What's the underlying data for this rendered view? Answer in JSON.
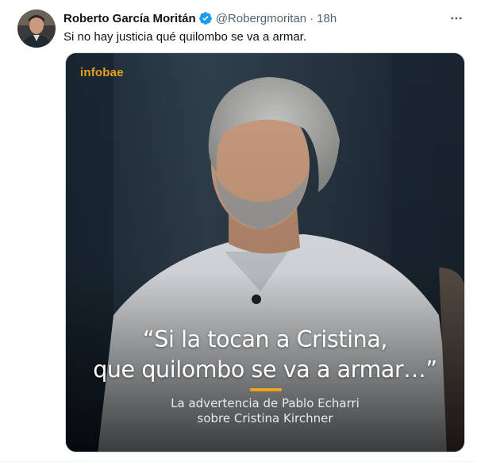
{
  "tweet": {
    "author": {
      "display_name": "Roberto García Moritán",
      "handle": "@Robergmoritan",
      "verified": true
    },
    "separator": "·",
    "timestamp": "18h",
    "text": "Si no hay justicia qué quilombo se va a armar.",
    "more_icon": "more-horizontal-icon"
  },
  "media": {
    "brand": "infobae",
    "quote_line_1": "“Si la tocan a Cristina,",
    "quote_line_2": "que quilombo se va a armar…”",
    "caption_line_1": "La advertencia de Pablo Echarri",
    "caption_line_2": "sobre Cristina Kirchner",
    "accent_color": "#f0a21b"
  },
  "colors": {
    "verified_badge": "#1d9bf0",
    "secondary_text": "#536471",
    "primary_text": "#0f1419"
  }
}
